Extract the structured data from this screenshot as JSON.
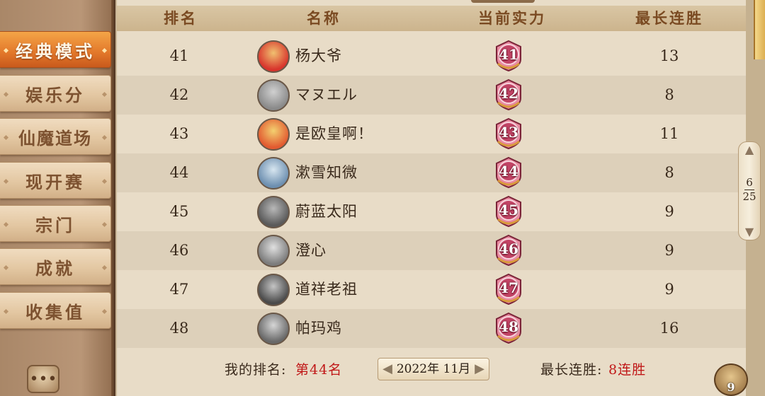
{
  "sidebar": {
    "items": [
      {
        "label": "经典模式",
        "active": true
      },
      {
        "label": "娱乐分",
        "active": false
      },
      {
        "label": "仙魔道场",
        "active": false
      },
      {
        "label": "现开赛",
        "active": false
      },
      {
        "label": "宗门",
        "active": false
      },
      {
        "label": "成就",
        "active": false
      },
      {
        "label": "收集值",
        "active": false
      }
    ],
    "chat_icon": "chat-bubble-icon"
  },
  "table": {
    "headers": {
      "rank": "排名",
      "name": "名称",
      "power": "当前实力",
      "streak": "最长连胜"
    },
    "rows": [
      {
        "rank": "41",
        "name": "杨大爷",
        "power": "41",
        "streak": "13"
      },
      {
        "rank": "42",
        "name": "マヌエル",
        "power": "42",
        "streak": "8"
      },
      {
        "rank": "43",
        "name": "是欧皇啊！",
        "power": "43",
        "streak": "11"
      },
      {
        "rank": "44",
        "name": "漱雪知微",
        "power": "44",
        "streak": "8"
      },
      {
        "rank": "45",
        "name": "蔚蓝太阳",
        "power": "45",
        "streak": "9"
      },
      {
        "rank": "46",
        "name": "澄心",
        "power": "46",
        "streak": "9"
      },
      {
        "rank": "47",
        "name": "道祥老祖",
        "power": "47",
        "streak": "9"
      },
      {
        "rank": "48",
        "name": "帕玛鸡",
        "power": "48",
        "streak": "16"
      }
    ]
  },
  "footer": {
    "my_rank_label": "我的排名:",
    "my_rank_value": "第44名",
    "date": "2022年 11月",
    "streak_label": "最长连胜:",
    "streak_value": "8连胜"
  },
  "pager": {
    "current": "6",
    "total": "25"
  },
  "corner": {
    "badge": "9"
  },
  "colors": {
    "accent": "#e2772a",
    "highlight_red": "#c01818",
    "badge_pink": "#e98aa0"
  }
}
